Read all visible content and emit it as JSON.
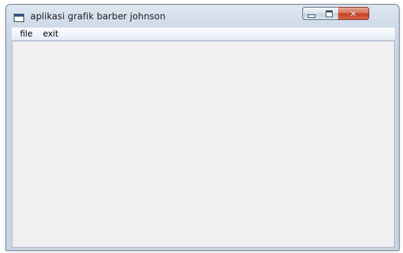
{
  "window": {
    "title": "aplikasi grafik barber johnson",
    "icon": "app-window-icon",
    "controls": {
      "minimize_icon": "minimize-icon",
      "maximize_icon": "maximize-icon",
      "close_icon": "close-icon",
      "close_glyph": "✕"
    }
  },
  "menubar": {
    "items": [
      {
        "label": "file"
      },
      {
        "label": "exit"
      }
    ]
  },
  "colors": {
    "titlebar": "#cfdbe8",
    "client_area": "#f0f0f0",
    "close_button": "#c43f22"
  }
}
